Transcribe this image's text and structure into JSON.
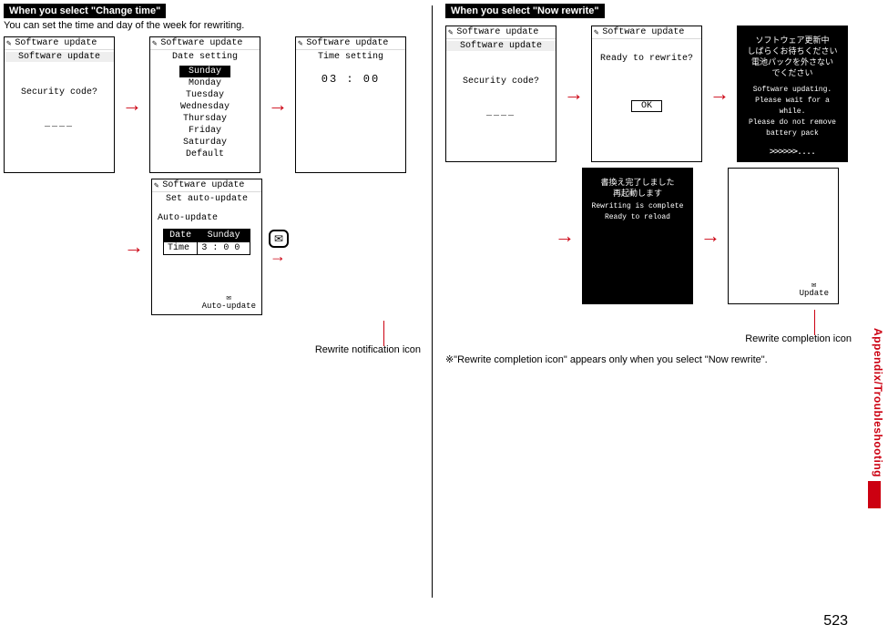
{
  "page_number": "523",
  "side_tab": "Appendix/Troubleshooting",
  "left": {
    "header": "When you select \"Change time\"",
    "intro": "You can set the time and day of the week for rewriting.",
    "screen1": {
      "title": "Software update",
      "sub": "Software update",
      "prompt": "Security code?",
      "input": "____"
    },
    "screen2": {
      "title": "Software update",
      "sub": "Date setting",
      "selected": "Sunday",
      "days": [
        "Monday",
        "Tuesday",
        "Wednesday",
        "Thursday",
        "Friday",
        "Saturday",
        "Default"
      ]
    },
    "screen3": {
      "title": "Software update",
      "sub": "Time setting",
      "time": "03 : 00"
    },
    "screen4": {
      "title": "Software update",
      "sub": "Set auto-update",
      "label": "Auto-update",
      "row_date_h": "Date",
      "row_date_v": "Sunday",
      "row_time_h": "Time",
      "row_time_v": "3 : 0 0",
      "tiny": "Auto-update"
    },
    "callout": "Rewrite notification icon"
  },
  "right": {
    "header": "When you select \"Now rewrite\"",
    "screen1": {
      "title": "Software update",
      "sub": "Software update",
      "prompt": "Security code?",
      "input": "____"
    },
    "screen2": {
      "title": "Software update",
      "sub": "Ready to rewrite?",
      "ok": "OK"
    },
    "screen3": {
      "jp1": "ソフトウェア更新中",
      "jp2": "しばらくお待ちください",
      "jp3": "電池パックを外さない",
      "jp4": "でください",
      "en1": "Software updating.",
      "en2": "Please wait for a while.",
      "en3": "Please do not remove",
      "en4": "battery pack",
      "chev": ">>>>>>...."
    },
    "screen4": {
      "jp1": "書換え完了しました",
      "jp2": "再起動します",
      "en1": "Rewriting is complete",
      "en2": "Ready to reload"
    },
    "screen5": {
      "tiny": "Update"
    },
    "callout": "Rewrite completion icon",
    "note": "※\"Rewrite completion icon\" appears only when you select \"Now rewrite\"."
  }
}
